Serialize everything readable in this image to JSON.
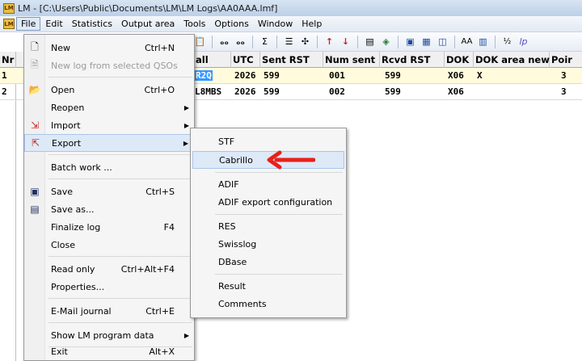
{
  "window": {
    "title": "LM - [C:\\Users\\Public\\Documents\\LM\\LM Logs\\AA0AAA.lmf]"
  },
  "menubar": {
    "items": [
      "File",
      "Edit",
      "Statistics",
      "Output area",
      "Tools",
      "Options",
      "Window",
      "Help"
    ]
  },
  "toolbar": {
    "icons": [
      "paste-icon",
      "binoculars-icon",
      "binoculars-next-icon",
      "sigma-icon",
      "list-icon",
      "plus-icon",
      "arrow-up-icon",
      "arrow-down-icon",
      "monitor-icon",
      "map-icon",
      "window-icon",
      "table-icon",
      "columns-icon",
      "font-icon",
      "grid-icon",
      "number-icon",
      "ip-icon"
    ],
    "text_ip": "lp"
  },
  "grid": {
    "columns": [
      "Nr",
      "all",
      "UTC",
      "Sent RST",
      "Num sent",
      "Rcvd RST",
      "DOK",
      "DOK area new",
      "Poir"
    ],
    "rows": [
      {
        "nr": "1",
        "call": "R2Q",
        "utc": "2026",
        "sent_rst": "599",
        "num_sent": "001",
        "rcvd_rst": "599",
        "dok": "X06",
        "dok_area_new": "X",
        "points": "3"
      },
      {
        "nr": "2",
        "call": "L8MBS",
        "utc": "2026",
        "sent_rst": "599",
        "num_sent": "002",
        "rcvd_rst": "599",
        "dok": "X06",
        "dok_area_new": "",
        "points": "3"
      }
    ]
  },
  "file_menu": {
    "items": [
      {
        "label": "New",
        "shortcut": "Ctrl+N"
      },
      {
        "label": "New log from selected QSOs",
        "disabled": true
      },
      {
        "label": "Open",
        "shortcut": "Ctrl+O"
      },
      {
        "label": "Reopen"
      },
      {
        "label": "Import"
      },
      {
        "label": "Export"
      },
      {
        "label": "Batch work ..."
      },
      {
        "label": "Save",
        "shortcut": "Ctrl+S"
      },
      {
        "label": "Save as..."
      },
      {
        "label": "Finalize log",
        "shortcut": "F4"
      },
      {
        "label": "Close"
      },
      {
        "label": "Read only",
        "shortcut": "Ctrl+Alt+F4"
      },
      {
        "label": "Properties..."
      },
      {
        "label": "E-Mail journal",
        "shortcut": "Ctrl+E"
      },
      {
        "label": "Show LM program data"
      },
      {
        "label": "Exit",
        "shortcut": "Alt+X"
      }
    ]
  },
  "export_submenu": {
    "items": [
      "STF",
      "Cabrillo",
      "ADIF",
      "ADIF export configuration",
      "RES",
      "Swisslog",
      "DBase",
      "Result",
      "Comments"
    ]
  },
  "colors": {
    "accent_highlight": "#3399ff",
    "annotation_arrow": "#e8201a",
    "selected_row": "#fffbdc"
  }
}
